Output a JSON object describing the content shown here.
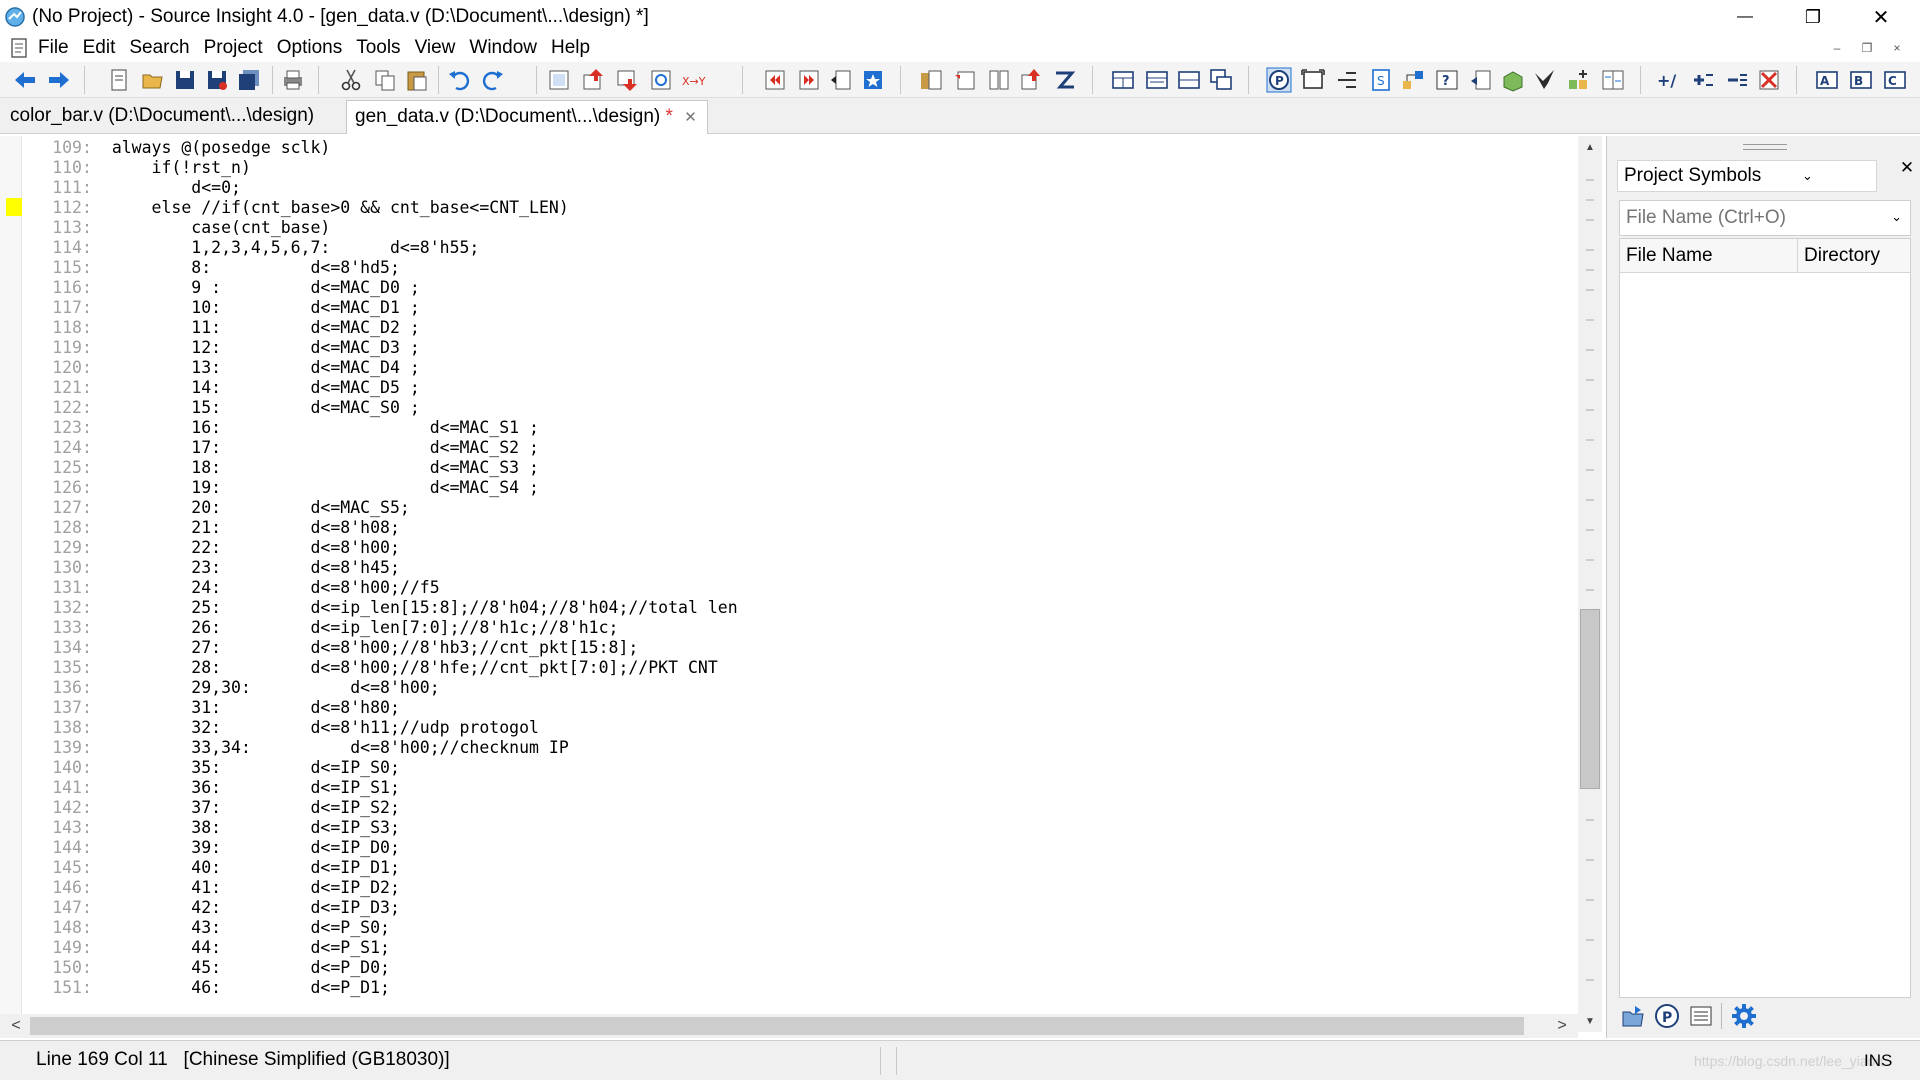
{
  "window": {
    "title": "(No Project) - Source Insight 4.0 - [gen_data.v (D:\\Document\\...\\design) *]",
    "min_glyph": "—",
    "max_glyph": "❐",
    "close_glyph": "✕"
  },
  "menu": {
    "items": [
      "File",
      "Edit",
      "Search",
      "Project",
      "Options",
      "Tools",
      "View",
      "Window",
      "Help"
    ],
    "mdi_min": "–",
    "mdi_restore": "❐",
    "mdi_close": "×"
  },
  "tabs": [
    {
      "label": "color_bar.v (D:\\Document\\...\\design)",
      "active": false
    },
    {
      "label": "gen_data.v (D:\\Document\\...\\design)",
      "modified_mark": "*",
      "close_glyph": "✕",
      "active": true
    }
  ],
  "editor": {
    "lines": [
      {
        "n": "109",
        "t": "always @(posedge sclk)"
      },
      {
        "n": "110",
        "t": "    if(!rst_n)"
      },
      {
        "n": "111",
        "t": "        d<=0;"
      },
      {
        "n": "112",
        "t": "    else //if(cnt_base>0 && cnt_base<=CNT_LEN)"
      },
      {
        "n": "113",
        "t": "        case(cnt_base)"
      },
      {
        "n": "114",
        "t": "        1,2,3,4,5,6,7:      d<=8'h55;"
      },
      {
        "n": "115",
        "t": "        8:          d<=8'hd5;"
      },
      {
        "n": "116",
        "t": "        9 :         d<=MAC_D0 ;"
      },
      {
        "n": "117",
        "t": "        10:         d<=MAC_D1 ;"
      },
      {
        "n": "118",
        "t": "        11:         d<=MAC_D2 ;"
      },
      {
        "n": "119",
        "t": "        12:         d<=MAC_D3 ;"
      },
      {
        "n": "120",
        "t": "        13:         d<=MAC_D4 ;"
      },
      {
        "n": "121",
        "t": "        14:         d<=MAC_D5 ;"
      },
      {
        "n": "122",
        "t": "        15:         d<=MAC_S0 ;"
      },
      {
        "n": "123",
        "t": "        16:                     d<=MAC_S1 ;"
      },
      {
        "n": "124",
        "t": "        17:                     d<=MAC_S2 ;"
      },
      {
        "n": "125",
        "t": "        18:                     d<=MAC_S3 ;"
      },
      {
        "n": "126",
        "t": "        19:                     d<=MAC_S4 ;"
      },
      {
        "n": "127",
        "t": "        20:         d<=MAC_S5;"
      },
      {
        "n": "128",
        "t": "        21:         d<=8'h08;"
      },
      {
        "n": "129",
        "t": "        22:         d<=8'h00;"
      },
      {
        "n": "130",
        "t": "        23:         d<=8'h45;"
      },
      {
        "n": "131",
        "t": "        24:         d<=8'h00;//f5"
      },
      {
        "n": "132",
        "t": "        25:         d<=ip_len[15:8];//8'h04;//8'h04;//total len"
      },
      {
        "n": "133",
        "t": "        26:         d<=ip_len[7:0];//8'h1c;//8'h1c;"
      },
      {
        "n": "134",
        "t": "        27:         d<=8'h00;//8'hb3;//cnt_pkt[15:8];"
      },
      {
        "n": "135",
        "t": "        28:         d<=8'h00;//8'hfe;//cnt_pkt[7:0];//PKT CNT"
      },
      {
        "n": "136",
        "t": "        29,30:          d<=8'h00;"
      },
      {
        "n": "137",
        "t": "        31:         d<=8'h80;"
      },
      {
        "n": "138",
        "t": "        32:         d<=8'h11;//udp protogol"
      },
      {
        "n": "139",
        "t": "        33,34:          d<=8'h00;//checknum IP"
      },
      {
        "n": "140",
        "t": "        35:         d<=IP_S0;"
      },
      {
        "n": "141",
        "t": "        36:         d<=IP_S1;"
      },
      {
        "n": "142",
        "t": "        37:         d<=IP_S2;"
      },
      {
        "n": "143",
        "t": "        38:         d<=IP_S3;"
      },
      {
        "n": "144",
        "t": "        39:         d<=IP_D0;"
      },
      {
        "n": "145",
        "t": "        40:         d<=IP_D1;"
      },
      {
        "n": "146",
        "t": "        41:         d<=IP_D2;"
      },
      {
        "n": "147",
        "t": "        42:         d<=IP_D3;"
      },
      {
        "n": "148",
        "t": "        43:         d<=P_S0;"
      },
      {
        "n": "149",
        "t": "        44:         d<=P_S1;"
      },
      {
        "n": "150",
        "t": "        45:         d<=P_D0;"
      },
      {
        "n": "151",
        "t": "        46:         d<=P_D1;"
      }
    ],
    "bookmark_color": "#ffff00"
  },
  "scroll": {
    "up": "▲",
    "down": "▼",
    "left": "<",
    "right": ">"
  },
  "panel": {
    "title": "Project Symbols",
    "dropdown_glyph": "⌄",
    "close_glyph": "✕",
    "search_placeholder": "File Name (Ctrl+O)",
    "search_caret": "⌄",
    "columns": [
      "File Name",
      "Directory"
    ]
  },
  "status": {
    "position": "Line 169  Col 11",
    "encoding": "[Chinese Simplified (GB18030)]",
    "watermark": "https://blog.csdn.net/lee_yiaon",
    "mode": "INS"
  },
  "colors": {
    "toolbar_blue": "#1e6fd0",
    "toolbar_red": "#d93025",
    "accent_yellow": "#ffff00"
  }
}
